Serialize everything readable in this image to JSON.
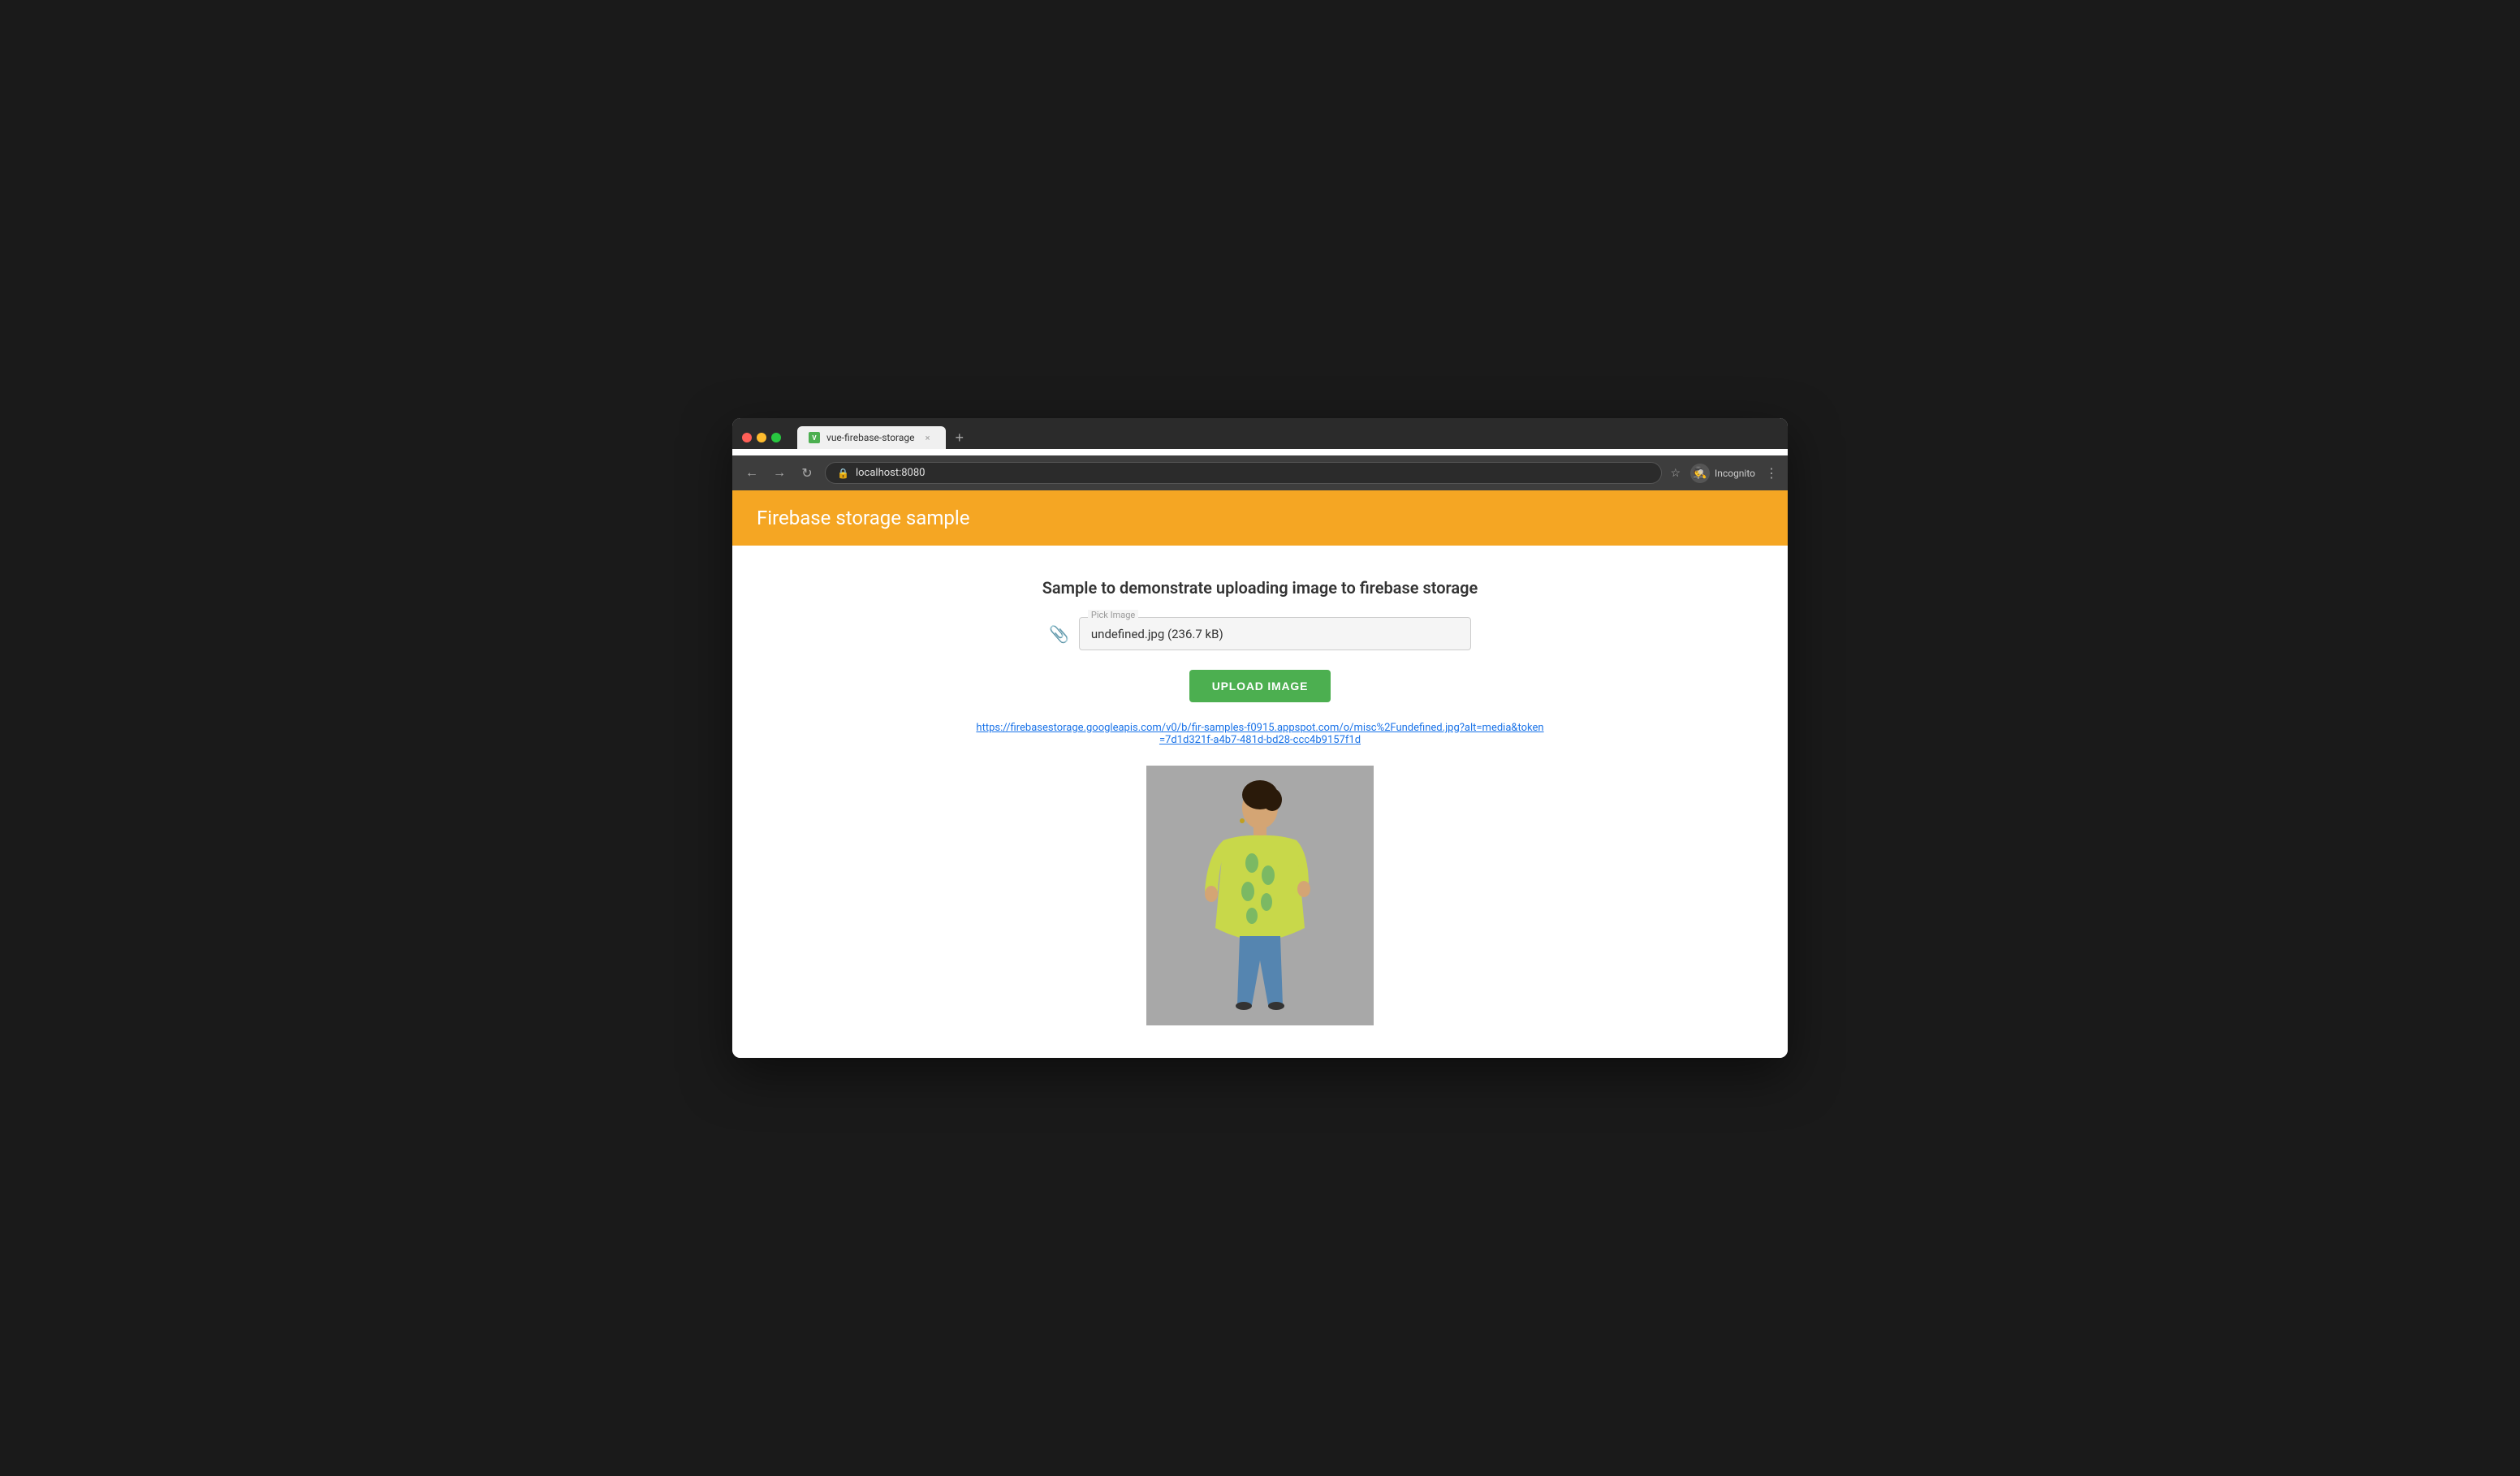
{
  "browser": {
    "tab": {
      "favicon_label": "V",
      "title": "vue-firebase-storage",
      "close_label": "×"
    },
    "tab_new_label": "+",
    "nav": {
      "back_label": "←",
      "forward_label": "→",
      "reload_label": "↻"
    },
    "address": {
      "icon_label": "🔒",
      "url": "localhost:8080"
    },
    "toolbar_right": {
      "star_label": "☆",
      "incognito_label": "Incognito",
      "menu_label": "⋮"
    }
  },
  "app": {
    "header": {
      "title": "Firebase storage sample",
      "bg_color": "#f5a623"
    },
    "body": {
      "page_title": "Sample to demonstrate uploading image to firebase storage",
      "file_input": {
        "label": "Pick Image",
        "value": "undefined.jpg (236.7 kB)"
      },
      "upload_button_label": "UPLOAD IMAGE",
      "firebase_url": "https://firebasestorage.googleapis.com/v0/b/fir-samples-f0915.appspot.com/o/misc%2Fundefined.jpg?alt=media&token=7d1d321f-a4b7-481d-bd28-ccc4b9157f1d"
    }
  }
}
